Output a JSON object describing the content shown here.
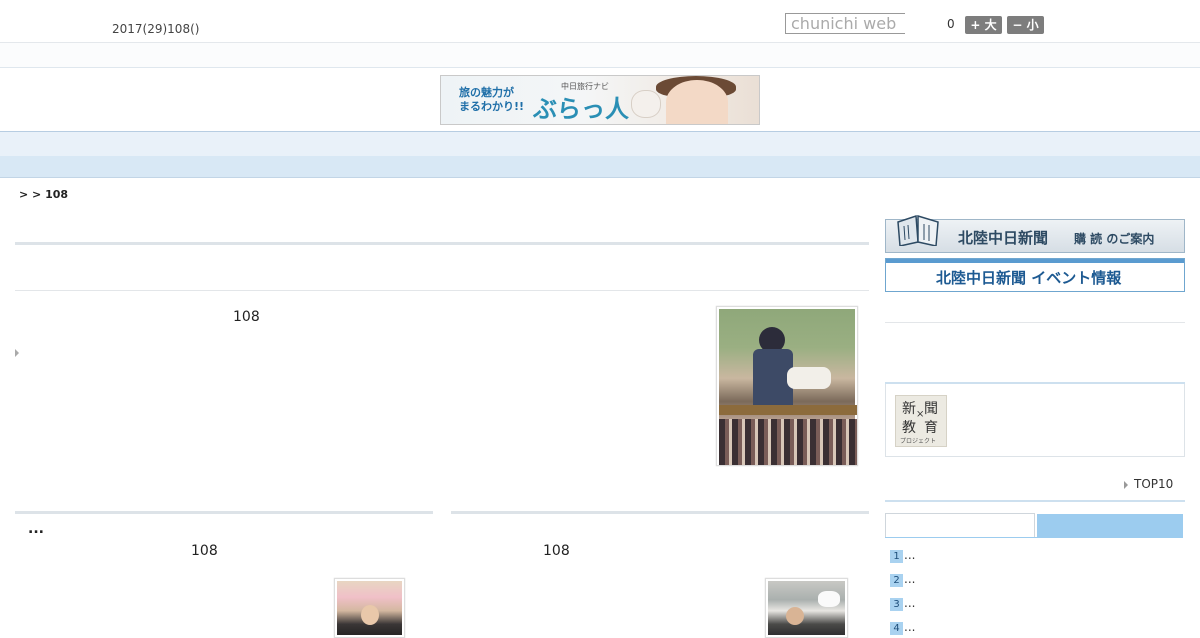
{
  "header": {
    "date": "2017(29)108()",
    "search_placeholder": "chunichi web",
    "counter": "0",
    "font_large_label": "+ 大",
    "font_small_label": "− 小"
  },
  "banner_ad": {
    "lead_line1": "旅の魅力が",
    "lead_line2": "まるわかり!!",
    "sub": "中日旅行ナビ",
    "brand": "ぶらっ人"
  },
  "nav": {
    "items": [
      "",
      "",
      "",
      "",
      "",
      "",
      "",
      "",
      ""
    ]
  },
  "breadcrumb": "> > 108",
  "main": {
    "headline": "108"
  },
  "lower": {
    "col1_title": "...",
    "col1_count": "108",
    "col2_count": "108"
  },
  "sidebar": {
    "subscribe_title": "北陸中日新聞",
    "subscribe_sub": "購 読 のご案内",
    "event_title": "北陸中日新聞 イベント情報",
    "edu_chars": [
      "新",
      "聞",
      "教",
      "育"
    ],
    "edu_cross": "×",
    "edu_small": "プロジェクト",
    "top10_label": "TOP10",
    "ranking": [
      {
        "num": "1",
        "text": "..."
      },
      {
        "num": "2",
        "text": "..."
      },
      {
        "num": "3",
        "text": "..."
      },
      {
        "num": "4",
        "text": "..."
      }
    ]
  },
  "colors": {
    "nav_bg": "#e9f1f9",
    "nav_sub_bg": "#d8e8f5",
    "tab_accent": "#9cccef",
    "button_gray": "#7d7d7d"
  }
}
